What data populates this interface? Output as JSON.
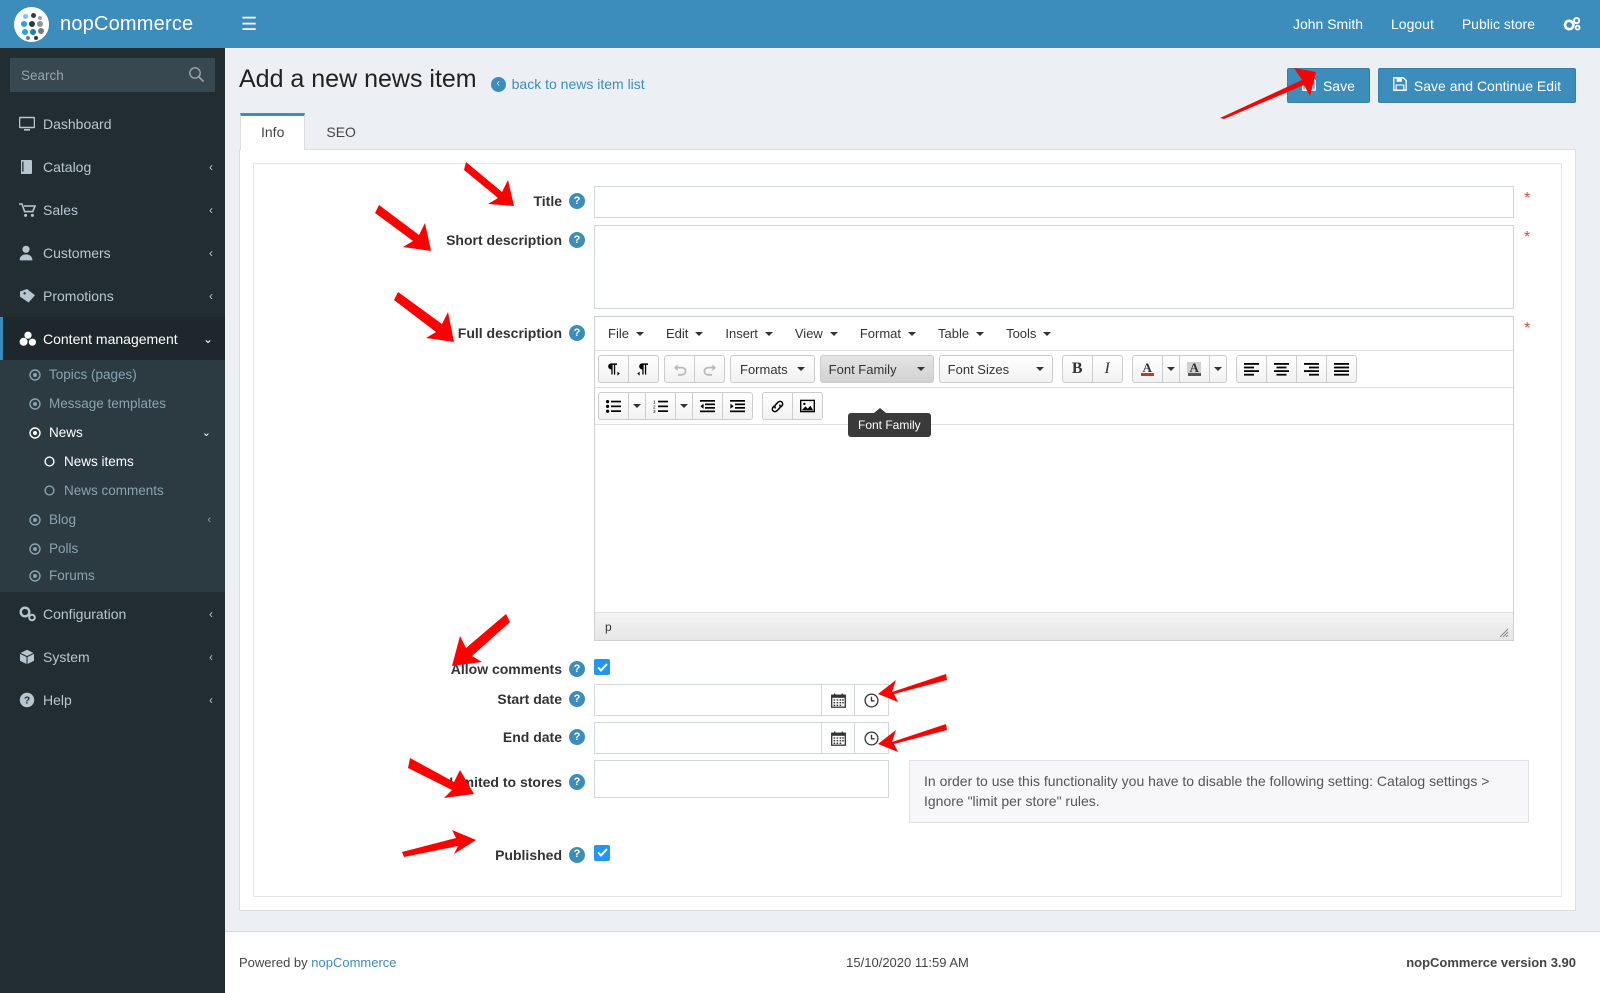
{
  "brand": {
    "name": "nopCommerce",
    "logo_icon": "nopcommerce-dots-logo"
  },
  "search": {
    "placeholder": "Search",
    "value": "",
    "icon": "search-icon"
  },
  "sidebar": {
    "items": [
      {
        "label": "Dashboard",
        "icon": "dashboard-monitor-icon",
        "chevron": ""
      },
      {
        "label": "Catalog",
        "icon": "book-icon",
        "chevron": "‹"
      },
      {
        "label": "Sales",
        "icon": "cart-icon",
        "chevron": "‹"
      },
      {
        "label": "Customers",
        "icon": "user-icon",
        "chevron": "‹"
      },
      {
        "label": "Promotions",
        "icon": "tag-icon",
        "chevron": "‹"
      },
      {
        "label": "Content management",
        "icon": "content-blocks-icon",
        "chevron": "⌄",
        "active": true
      }
    ],
    "content_children": [
      {
        "label": "Topics (pages)",
        "icon": "circle-dot-icon",
        "chevron": ""
      },
      {
        "label": "Message templates",
        "icon": "circle-dot-icon",
        "chevron": ""
      },
      {
        "label": "News",
        "icon": "circle-dot-icon",
        "chevron": "⌄",
        "current": true
      },
      {
        "label": "News items",
        "icon": "circle-icon",
        "level": 2,
        "current": true
      },
      {
        "label": "News comments",
        "icon": "circle-icon",
        "level": 2
      },
      {
        "label": "Blog",
        "icon": "circle-dot-icon",
        "chevron": "‹"
      },
      {
        "label": "Polls",
        "icon": "circle-dot-icon",
        "chevron": ""
      },
      {
        "label": "Forums",
        "icon": "circle-dot-icon",
        "chevron": ""
      }
    ],
    "bottom_items": [
      {
        "label": "Configuration",
        "icon": "gears-icon",
        "chevron": "‹"
      },
      {
        "label": "System",
        "icon": "box-icon",
        "chevron": "‹"
      },
      {
        "label": "Help",
        "icon": "question-circle-icon",
        "chevron": "‹"
      }
    ]
  },
  "topbar": {
    "menu_toggle_icon": "hamburger-icon",
    "user": "John Smith",
    "logout": "Logout",
    "public_store": "Public store",
    "settings_icon": "gears-icon"
  },
  "header": {
    "title": "Add a new news item",
    "back_link": "back to news item list",
    "back_icon": "arrow-left-circle-icon",
    "save_label": "Save",
    "save_continue_label": "Save and Continue Edit",
    "save_icon": "floppy-disk-icon"
  },
  "tabs": [
    {
      "label": "Info",
      "active": true
    },
    {
      "label": "SEO",
      "active": false
    }
  ],
  "form": {
    "title": {
      "label": "Title",
      "value": "",
      "required": true
    },
    "short_description": {
      "label": "Short description",
      "value": "",
      "required": true
    },
    "full_description": {
      "label": "Full description",
      "value": "",
      "required": true
    },
    "allow_comments": {
      "label": "Allow comments",
      "checked": true
    },
    "start_date": {
      "label": "Start date",
      "value": ""
    },
    "end_date": {
      "label": "End date",
      "value": ""
    },
    "limited_to_stores": {
      "label": "Limited to stores",
      "value": ""
    },
    "published": {
      "label": "Published",
      "checked": true
    },
    "store_note": "In order to use this functionality you have to disable the following setting: Catalog settings > Ignore \"limit per store\" rules.",
    "required_mark": "*",
    "help_glyph": "?"
  },
  "editor": {
    "menus": [
      "File",
      "Edit",
      "Insert",
      "View",
      "Format",
      "Table",
      "Tools"
    ],
    "formats_label": "Formats",
    "font_family_label": "Font Family",
    "font_sizes_label": "Font Sizes",
    "tooltip": "Font Family",
    "status_path": "p",
    "buttons": {
      "ltr": "ltr-paragraph-icon",
      "rtl": "rtl-paragraph-icon",
      "undo": "undo-icon",
      "redo": "redo-icon",
      "bold": "B",
      "italic": "I",
      "text_color": "A",
      "background_color": "A",
      "align_left": "align-left-icon",
      "align_center": "align-center-icon",
      "align_right": "align-right-icon",
      "align_justify": "align-justify-icon",
      "bullet_list": "bullet-list-icon",
      "number_list": "numbered-list-icon",
      "outdent": "outdent-icon",
      "indent": "indent-icon",
      "link": "link-icon",
      "image": "image-icon"
    }
  },
  "footer": {
    "powered_by": "Powered by ",
    "powered_link": "nopCommerce",
    "timestamp": "15/10/2020 11:59 AM",
    "version": "nopCommerce version 3.90"
  },
  "colors": {
    "brand_blue": "#3c8dbc",
    "sidebar_dark": "#222d32",
    "sidebar_sub": "#2c3b41",
    "required_red": "#dd4b39",
    "annotation_red": "#ff0000",
    "page_bg": "#ecf0f5"
  }
}
